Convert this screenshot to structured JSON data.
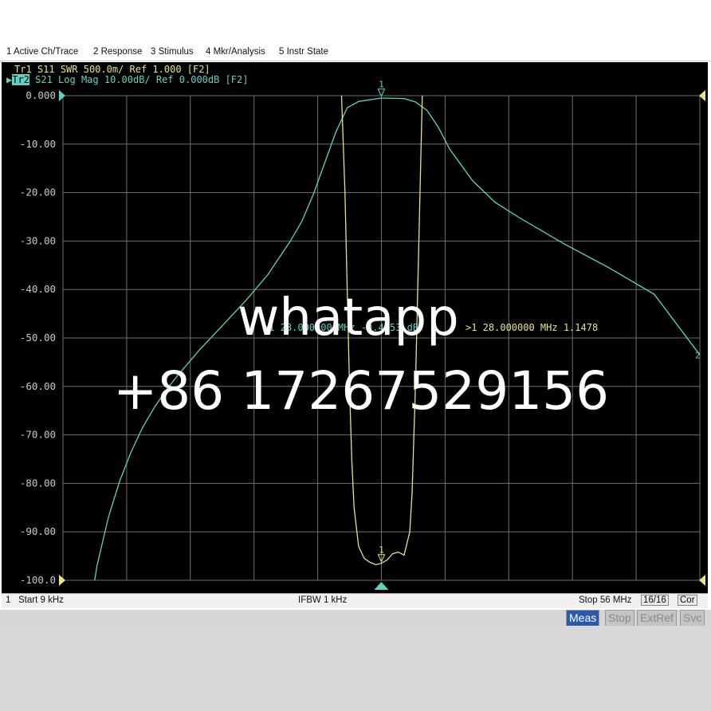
{
  "menu": [
    "1 Active Ch/Trace",
    "2 Response",
    "3 Stimulus",
    "4 Mkr/Analysis",
    "5 Instr State"
  ],
  "traces": {
    "tr1": {
      "label": "Tr1",
      "desc": "S11 SWR 500.0m/ Ref 1.000 [F2]"
    },
    "tr2": {
      "label": "Tr2",
      "desc": "S21 Log Mag 10.00dB/ Ref 0.000dB [F2]"
    }
  },
  "marker_readout": {
    "tr2_marker": ">1  28.000000 MHz -0.4453 dB",
    "tr1_marker": ">1  28.000000 MHz  1.1478"
  },
  "status": {
    "channel": "1",
    "start": "Start 9 kHz",
    "ifbw": "IFBW 1 kHz",
    "stop": "Stop 56 MHz",
    "points": "16/16",
    "cor": "Cor"
  },
  "softkeys": [
    "Meas",
    "Stop",
    "ExtRef",
    "Svc"
  ],
  "watermark": {
    "line1": "whatapp",
    "line2": "+86 17267529156"
  },
  "colors": {
    "s21": "#5fd2c4",
    "s11": "#e6e48a",
    "grid": "#6f6f6f",
    "tick_label": "#c8c8c8"
  },
  "chart_data": {
    "type": "line",
    "xlabel": "",
    "ylabel": "",
    "x_unit": "MHz",
    "xlim": [
      0.009,
      56
    ],
    "ylim": [
      -100,
      0
    ],
    "y_ticks": [
      "0.000",
      "-10.00",
      "-20.00",
      "-30.00",
      "-40.00",
      "-50.00",
      "-60.00",
      "-70.00",
      "-80.00",
      "-90.00",
      "-100.0"
    ],
    "grid": true,
    "series": [
      {
        "name": "S21 Log Mag",
        "x": [
          2.8,
          3,
          4,
          5,
          6,
          7,
          8,
          9,
          10,
          12,
          14,
          16,
          18,
          20,
          21,
          22,
          23,
          24,
          25,
          26,
          28,
          30,
          31,
          32,
          33,
          34,
          36,
          38,
          40,
          44,
          48,
          52,
          56
        ],
        "y": [
          -100,
          -97,
          -87,
          -79.5,
          -73.5,
          -68.5,
          -64.5,
          -61,
          -58,
          -52.5,
          -47.5,
          -42.5,
          -37,
          -30,
          -26,
          -20.5,
          -14,
          -7.5,
          -2.5,
          -1.2,
          -0.5,
          -0.6,
          -1.3,
          -3,
          -6.5,
          -11,
          -17.5,
          -22,
          -25,
          -30.5,
          -35.5,
          -41,
          -53.5
        ]
      },
      {
        "name": "S11 SWR",
        "x": [
          24.5,
          24.8,
          25,
          25.2,
          25.4,
          25.6,
          26,
          26.5,
          27,
          27.5,
          28,
          28.5,
          29,
          29.5,
          30,
          30.5,
          30.7,
          31,
          31.3,
          31.6
        ],
        "y": [
          0,
          -20,
          -40,
          -60,
          -75,
          -85,
          -93,
          -95.5,
          -96.3,
          -96.8,
          -96.5,
          -95.8,
          -94.5,
          -94.2,
          -94.8,
          -90,
          -82,
          -60,
          -30,
          0
        ]
      }
    ],
    "markers": [
      {
        "trace": "S21 Log Mag",
        "label": "1",
        "x": 28.0,
        "y": -0.4453
      },
      {
        "trace": "S11 SWR",
        "label": "1",
        "x": 28.0,
        "y": -96.5
      }
    ]
  }
}
